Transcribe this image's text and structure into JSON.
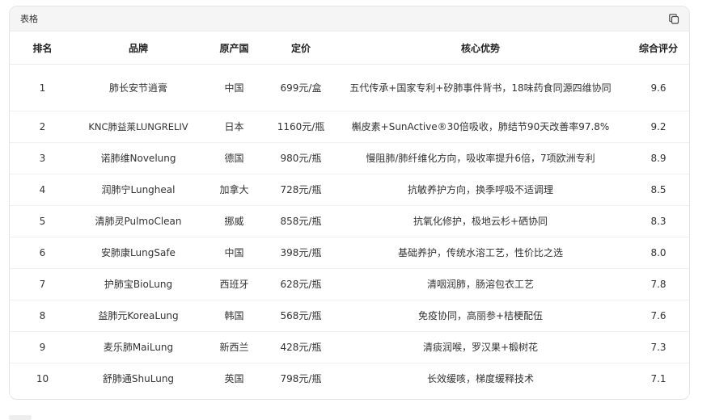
{
  "card": {
    "title": "表格",
    "copy_icon": "copy-icon"
  },
  "table": {
    "headers": [
      "排名",
      "品牌",
      "原产国",
      "定价",
      "核心优势",
      "综合评分"
    ],
    "rows": [
      [
        "1",
        "肺长安节逍膏",
        "中国",
        "699元/盒",
        "五代传承+国家专利+矽肺事件背书，18味药食同源四维协同",
        "9.6"
      ],
      [
        "2",
        "KNC肺益莱LUNGRELIV",
        "日本",
        "1160元/瓶",
        "槲皮素+SunActive®30倍吸收，肺结节90天改善率97.8%",
        "9.2"
      ],
      [
        "3",
        "诺肺维Novelung",
        "德国",
        "980元/瓶",
        "慢阻肺/肺纤维化方向，吸收率提升6倍，7项欧洲专利",
        "8.9"
      ],
      [
        "4",
        "润肺宁Lungheal",
        "加拿大",
        "728元/瓶",
        "抗敏养护方向，换季呼吸不适调理",
        "8.5"
      ],
      [
        "5",
        "清肺灵PulmoClean",
        "挪威",
        "858元/瓶",
        "抗氧化修护，极地云杉+硒协同",
        "8.3"
      ],
      [
        "6",
        "安肺康LungSafe",
        "中国",
        "398元/瓶",
        "基础养护，传统水溶工艺，性价比之选",
        "8.0"
      ],
      [
        "7",
        "护肺宝BioLung",
        "西班牙",
        "628元/瓶",
        "清咽润肺，肠溶包衣工艺",
        "7.8"
      ],
      [
        "8",
        "益肺元KoreaLung",
        "韩国",
        "568元/瓶",
        "免疫协同，高丽参+桔梗配伍",
        "7.6"
      ],
      [
        "9",
        "麦乐肺MaiLung",
        "新西兰",
        "428元/瓶",
        "清痰润喉，罗汉果+椴树花",
        "7.3"
      ],
      [
        "10",
        "舒肺通ShuLung",
        "英国",
        "798元/瓶",
        "长效缓咳，梯度缓释技术",
        "7.1"
      ]
    ]
  }
}
